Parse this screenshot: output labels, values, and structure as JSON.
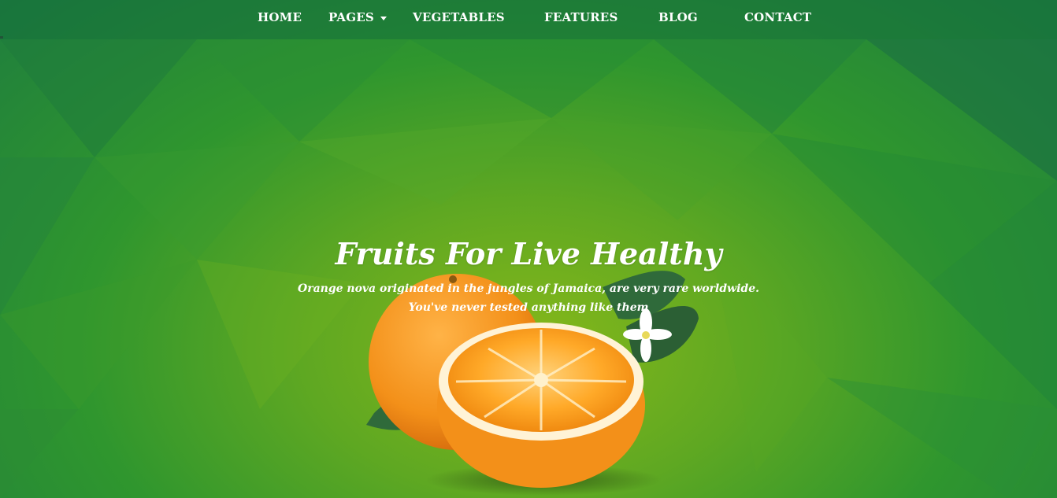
{
  "nav": {
    "items": [
      {
        "label": "HOME"
      },
      {
        "label": "PAGES",
        "dropdown": true
      },
      {
        "label": "VEGETABLES"
      },
      {
        "label": "FEATURES"
      },
      {
        "label": "BLOG"
      },
      {
        "label": "CONTACT"
      }
    ]
  },
  "hero": {
    "title": "Fruits For Live Healthy",
    "subtitle_line1": "Orange nova originated in the jungles of Jamaica, are very rare worldwide.",
    "subtitle_line2": "You've never tested anything like them"
  },
  "colors": {
    "bg_light": "#86b81a",
    "bg_dark": "#1f7e3e",
    "nav_bg": "#146e3c",
    "orange": "#f5921e",
    "leaf": "#2f6a3a",
    "text": "#ffffff"
  },
  "icons": [
    "chevron-down-icon",
    "orange-fruit-image",
    "leaf-decoration",
    "orange-blossom-icon"
  ]
}
